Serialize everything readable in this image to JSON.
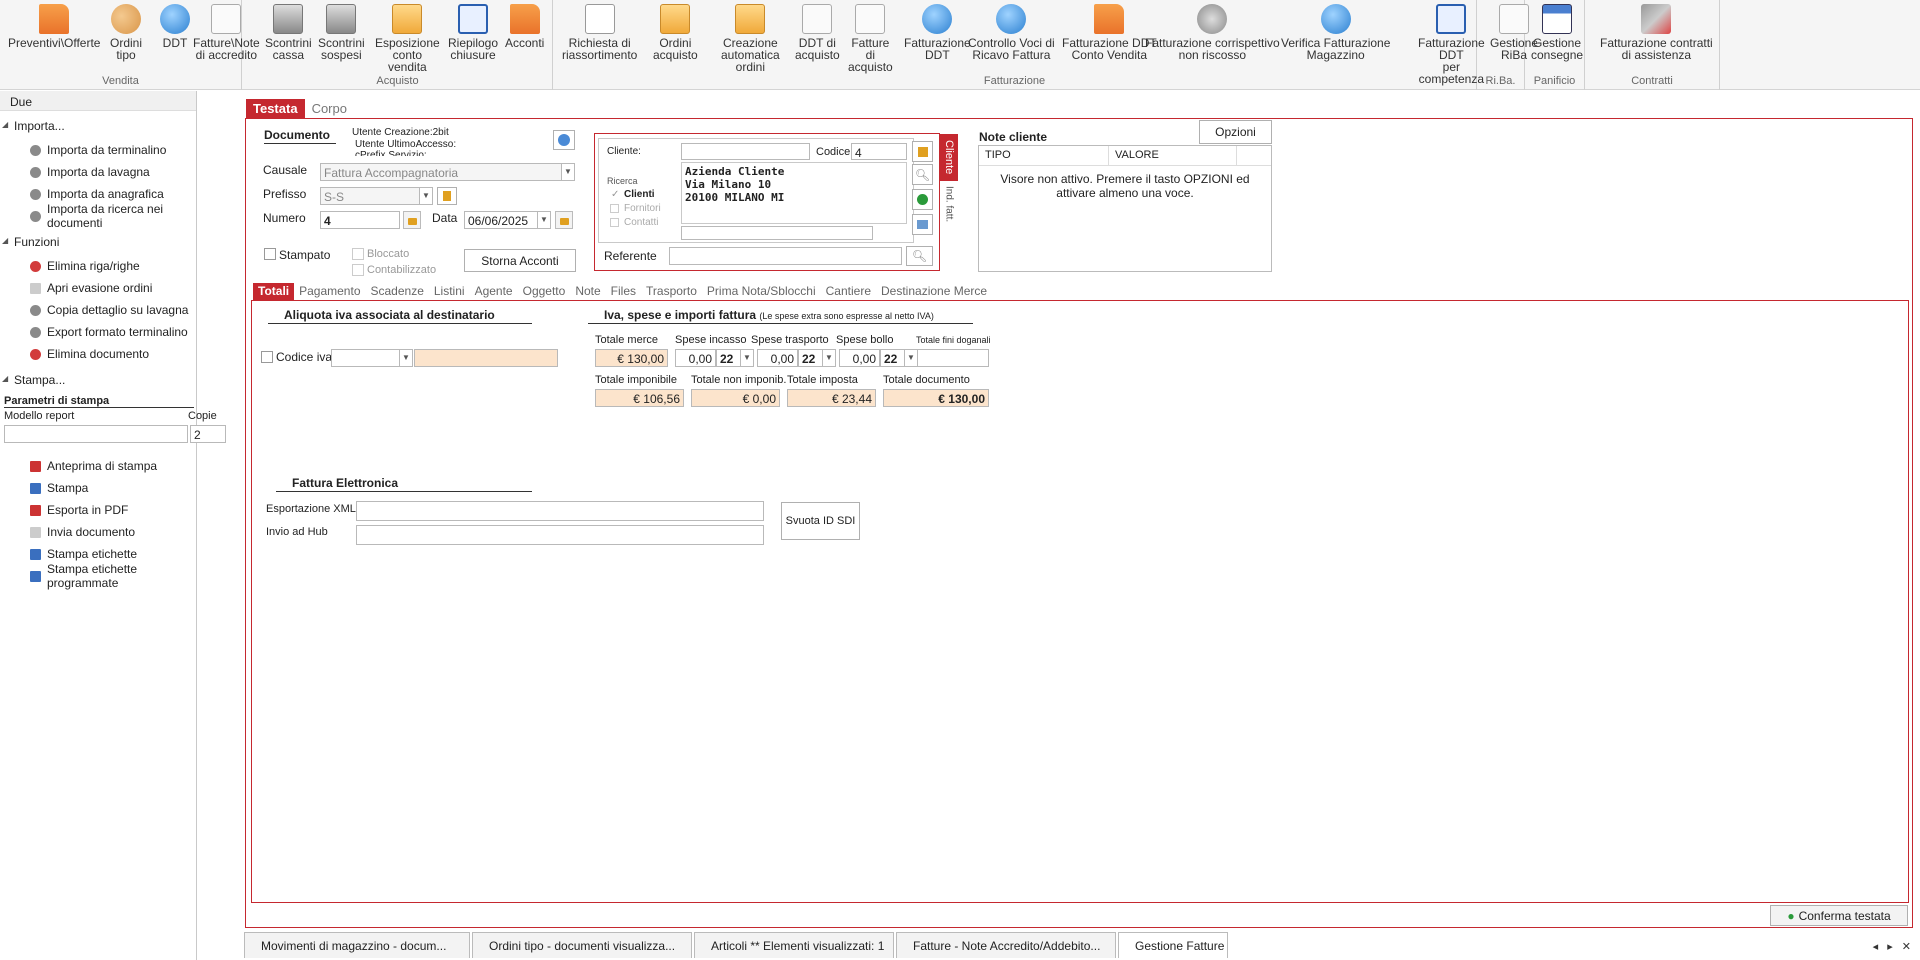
{
  "ribbon": {
    "groups": [
      {
        "title": "Vendita",
        "buttons": [
          {
            "label": "Preventivi\\Offerte",
            "icon": "folder-icon"
          },
          {
            "label": "Ordini\ntipo",
            "icon": "people-icon"
          },
          {
            "label": "DDT",
            "icon": "globe-icon"
          },
          {
            "label": "Fatture\\Note\ndi accredito",
            "icon": "document-icon"
          },
          {
            "label": "Scontrini\ncassa",
            "icon": "printer-icon"
          },
          {
            "label": "Scontrini\nsospesi",
            "icon": "printer-icon"
          },
          {
            "label": "Esposizione\nconto vendita",
            "icon": "box-icon"
          },
          {
            "label": "Riepilogo\nchiusure",
            "icon": "chart-icon"
          },
          {
            "label": "Acconti",
            "icon": "folder-icon"
          }
        ]
      },
      {
        "title": "Acquisto",
        "buttons": [
          {
            "label": "Richiesta di\nriassortimento",
            "icon": "abc-icon"
          },
          {
            "label": "Ordini\nacquisto",
            "icon": "box-icon"
          },
          {
            "label": "Creazione\nautomatica ordini",
            "icon": "box-icon"
          },
          {
            "label": "DDT di\nacquisto",
            "icon": "document-icon"
          },
          {
            "label": "Fatture di\nacquisto",
            "icon": "document-icon"
          }
        ]
      },
      {
        "title": "Fatturazione",
        "buttons": [
          {
            "label": "Fatturazione\nDDT",
            "icon": "globe-icon"
          },
          {
            "label": "Controllo Voci di\nRicavo Fattura",
            "icon": "globe-icon"
          },
          {
            "label": "Fatturazione DDT\nConto Vendita",
            "icon": "folder-icon"
          },
          {
            "label": "Fatturazione corrispettivo\nnon riscosso",
            "icon": "gear-icon"
          },
          {
            "label": "Verifica Fatturazione\nMagazzino",
            "icon": "globe-icon"
          },
          {
            "label": "Fatturazione DDT\nper competenza",
            "icon": "chart-icon"
          }
        ]
      },
      {
        "title": "Ri.Ba.",
        "buttons": [
          {
            "label": "Gestione\nRiBa",
            "icon": "document-icon"
          }
        ]
      },
      {
        "title": "Panificio",
        "buttons": [
          {
            "label": "Gestione\nconsegne",
            "icon": "calendar-icon"
          }
        ]
      },
      {
        "title": "Contratti",
        "buttons": [
          {
            "label": "Fatturazione contratti\ndi assistenza",
            "icon": "tools-icon"
          }
        ]
      }
    ]
  },
  "sidebar": {
    "header": "Due",
    "import_title": "Importa...",
    "import_items": [
      "Importa da terminalino",
      "Importa da lavagna",
      "Importa da anagrafica",
      "Importa da ricerca nei documenti"
    ],
    "functions_title": "Funzioni",
    "function_items": [
      "Elimina riga/righe",
      "Apri evasione ordini",
      "Copia dettaglio su lavagna",
      "Export formato terminalino",
      "Elimina documento"
    ],
    "print_title": "Stampa...",
    "print_params_title": "Parametri di stampa",
    "report_model_label": "Modello report",
    "copies_label": "Copie",
    "copies_value": "2",
    "print_items": [
      "Anteprima di stampa",
      "Stampa",
      "Esporta in PDF",
      "Invia documento",
      "Stampa etichette",
      "Stampa etichette programmate"
    ]
  },
  "main_tabs": [
    "Testata",
    "Corpo"
  ],
  "document": {
    "section_title": "Documento",
    "user_creation": "Utente Creazione:2bit",
    "user_last_access": "Utente UltimoAccesso:",
    "user_extra": "cPrefix Servizio:",
    "causale_label": "Causale",
    "causale_value": "Fattura Accompagnatoria",
    "prefisso_label": "Prefisso",
    "prefisso_value": "S-S",
    "numero_label": "Numero",
    "numero_value": "4",
    "data_label": "Data",
    "data_value": "06/06/2025",
    "stampato_label": "Stampato",
    "bloccato_label": "Bloccato",
    "contabilizzato_label": "Contabilizzato",
    "storna_button": "Storna Acconti"
  },
  "cliente": {
    "cliente_label": "Cliente:",
    "codice_label": "Codice",
    "codice_value": "4",
    "ricerca_label": "Ricerca",
    "clienti_label": "Clienti",
    "fornitori_label": "Fornitori",
    "contatti_label": "Contatti",
    "address_line1": "Azienda Cliente",
    "address_line2": "Via Milano 10",
    "address_line3": "20100 MILANO MI",
    "referente_label": "Referente",
    "side_tab_cliente": "Cliente",
    "side_tab_ind": "Ind. fatt."
  },
  "note_cliente": {
    "title": "Note cliente",
    "opzioni_button": "Opzioni",
    "col_tipo": "TIPO",
    "col_valore": "VALORE",
    "message": "Visore non attivo. Premere il tasto OPZIONI ed attivare almeno una voce."
  },
  "sub_tabs": [
    "Totali",
    "Pagamento",
    "Scadenze",
    "Listini",
    "Agente",
    "Oggetto",
    "Note",
    "Files",
    "Trasporto",
    "Prima Nota/Sblocchi",
    "Cantiere",
    "Destinazione Merce"
  ],
  "totali": {
    "aliquota_title": "Aliquota iva associata al destinatario",
    "codice_iva_label": "Codice iva",
    "iva_title": "Iva, spese e importi fattura",
    "iva_note": "(Le spese extra sono espresse al netto IVA)",
    "totale_merce_label": "Totale merce",
    "totale_merce_value": "€ 130,00",
    "spese_incasso_label": "Spese incasso",
    "spese_incasso_value": "0,00",
    "spese_incasso_iva": "22",
    "spese_trasporto_label": "Spese trasporto",
    "spese_trasporto_value": "0,00",
    "spese_trasporto_iva": "22",
    "spese_bollo_label": "Spese bollo",
    "spese_bollo_value": "0,00",
    "spese_bollo_iva": "22",
    "totale_fini_label": "Totale fini doganali",
    "totale_imponibile_label": "Totale imponibile",
    "totale_imponibile_value": "€ 106,56",
    "totale_non_imponib_label": "Totale non imponib.",
    "totale_non_imponib_value": "€ 0,00",
    "totale_imposta_label": "Totale imposta",
    "totale_imposta_value": "€ 23,44",
    "totale_documento_label": "Totale documento",
    "totale_documento_value": "€ 130,00",
    "fattura_el_title": "Fattura Elettronica",
    "esportazione_label": "Esportazione XML",
    "invio_label": "Invio ad Hub",
    "svuota_button": "Svuota ID SDI"
  },
  "conferma_button": "Conferma testata",
  "bottom_tabs": [
    "Movimenti di magazzino - docum...",
    "Ordini tipo - documenti visualizza...",
    "Articoli ** Elementi visualizzati: 1",
    "Fatture - Note Accredito/Addebito...",
    "Gestione Fatture"
  ],
  "nav_controls": "◂ ▸ ✕"
}
